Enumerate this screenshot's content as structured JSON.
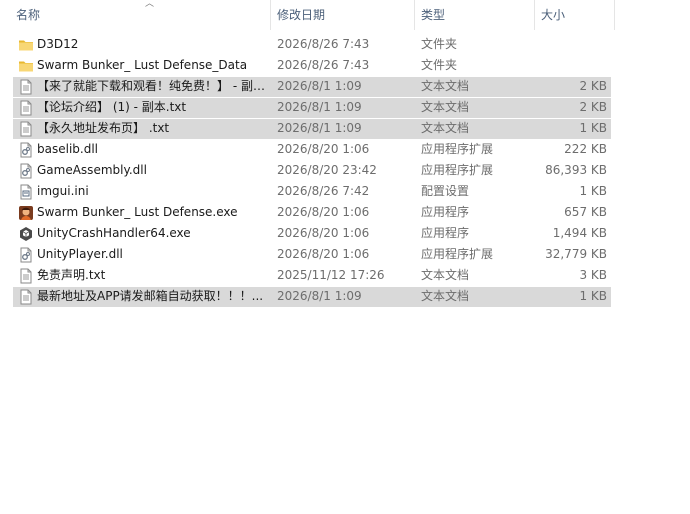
{
  "columns": {
    "name": "名称",
    "date": "修改日期",
    "type": "类型",
    "size": "大小"
  },
  "files": [
    {
      "icon": "folder-icon",
      "name": "D3D12",
      "date": "2026/8/26 7:43",
      "type": "文件夹",
      "size": "",
      "selected": false
    },
    {
      "icon": "folder-icon",
      "name": "Swarm Bunker_ Lust Defense_Data",
      "date": "2026/8/26 7:43",
      "type": "文件夹",
      "size": "",
      "selected": false
    },
    {
      "icon": "text-file-icon",
      "name": "【来了就能下载和观看！纯免费！】 - 副…",
      "date": "2026/8/1 1:09",
      "type": "文本文档",
      "size": "2 KB",
      "selected": true
    },
    {
      "icon": "text-file-icon",
      "name": "【论坛介绍】 (1) - 副本.txt",
      "date": "2026/8/1 1:09",
      "type": "文本文档",
      "size": "2 KB",
      "selected": true
    },
    {
      "icon": "text-file-icon",
      "name": "【永久地址发布页】 .txt",
      "date": "2026/8/1 1:09",
      "type": "文本文档",
      "size": "1 KB",
      "selected": true
    },
    {
      "icon": "dll-file-icon",
      "name": "baselib.dll",
      "date": "2026/8/20 1:06",
      "type": "应用程序扩展",
      "size": "222 KB",
      "selected": false
    },
    {
      "icon": "dll-file-icon",
      "name": "GameAssembly.dll",
      "date": "2026/8/20 23:42",
      "type": "应用程序扩展",
      "size": "86,393 KB",
      "selected": false
    },
    {
      "icon": "config-file-icon",
      "name": "imgui.ini",
      "date": "2026/8/26 7:42",
      "type": "配置设置",
      "size": "1 KB",
      "selected": false
    },
    {
      "icon": "game-exe-icon",
      "name": "Swarm Bunker_ Lust Defense.exe",
      "date": "2026/8/20 1:06",
      "type": "应用程序",
      "size": "657 KB",
      "selected": false
    },
    {
      "icon": "unity-exe-icon",
      "name": "UnityCrashHandler64.exe",
      "date": "2026/8/20 1:06",
      "type": "应用程序",
      "size": "1,494 KB",
      "selected": false
    },
    {
      "icon": "dll-file-icon",
      "name": "UnityPlayer.dll",
      "date": "2026/8/20 1:06",
      "type": "应用程序扩展",
      "size": "32,779 KB",
      "selected": false
    },
    {
      "icon": "text-file-icon",
      "name": "免责声明.txt",
      "date": "2025/11/12 17:26",
      "type": "文本文档",
      "size": "3 KB",
      "selected": false
    },
    {
      "icon": "text-file-icon",
      "name": "最新地址及APP请发邮箱自动获取！！！...",
      "date": "2026/8/1 1:09",
      "type": "文本文档",
      "size": "1 KB",
      "selected": true
    }
  ]
}
